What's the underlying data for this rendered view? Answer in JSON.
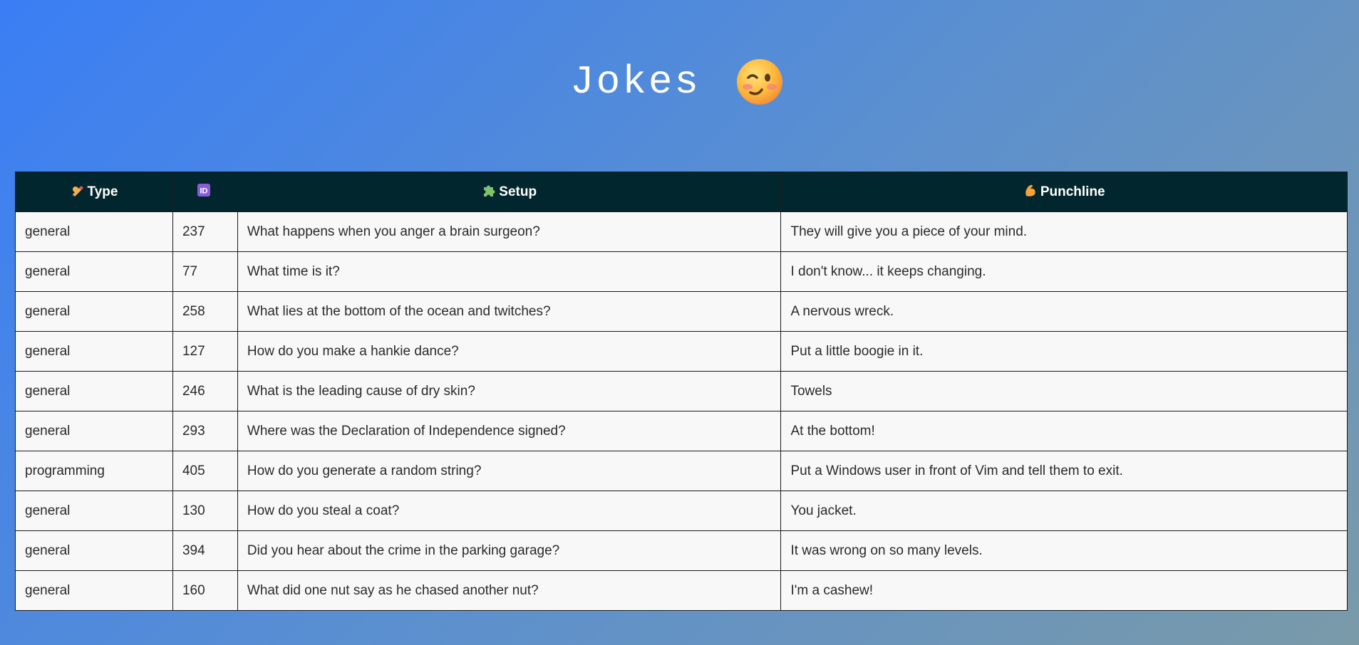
{
  "page": {
    "title": "Jokes",
    "title_icon": "winking-face-icon",
    "background_gradient": [
      "#3a7ef5",
      "#7a9aa8"
    ]
  },
  "table": {
    "header_bg": "#02262e",
    "columns": [
      {
        "label": "Type",
        "icon": "writing-hand-icon"
      },
      {
        "label": "",
        "icon": "id-badge-icon"
      },
      {
        "label": "Setup",
        "icon": "puzzle-piece-icon"
      },
      {
        "label": "Punchline",
        "icon": "flexed-biceps-icon"
      }
    ],
    "rows": [
      {
        "type": "general",
        "id": "237",
        "setup": "What happens when you anger a brain surgeon?",
        "punchline": "They will give you a piece of your mind."
      },
      {
        "type": "general",
        "id": "77",
        "setup": "What time is it?",
        "punchline": "I don't know... it keeps changing."
      },
      {
        "type": "general",
        "id": "258",
        "setup": "What lies at the bottom of the ocean and twitches?",
        "punchline": "A nervous wreck."
      },
      {
        "type": "general",
        "id": "127",
        "setup": "How do you make a hankie dance?",
        "punchline": "Put a little boogie in it."
      },
      {
        "type": "general",
        "id": "246",
        "setup": "What is the leading cause of dry skin?",
        "punchline": "Towels"
      },
      {
        "type": "general",
        "id": "293",
        "setup": "Where was the Declaration of Independence signed?",
        "punchline": "At the bottom!"
      },
      {
        "type": "programming",
        "id": "405",
        "setup": "How do you generate a random string?",
        "punchline": "Put a Windows user in front of Vim and tell them to exit."
      },
      {
        "type": "general",
        "id": "130",
        "setup": "How do you steal a coat?",
        "punchline": "You jacket."
      },
      {
        "type": "general",
        "id": "394",
        "setup": "Did you hear about the crime in the parking garage?",
        "punchline": "It was wrong on so many levels."
      },
      {
        "type": "general",
        "id": "160",
        "setup": "What did one nut say as he chased another nut?",
        "punchline": "I'm a cashew!"
      }
    ]
  }
}
